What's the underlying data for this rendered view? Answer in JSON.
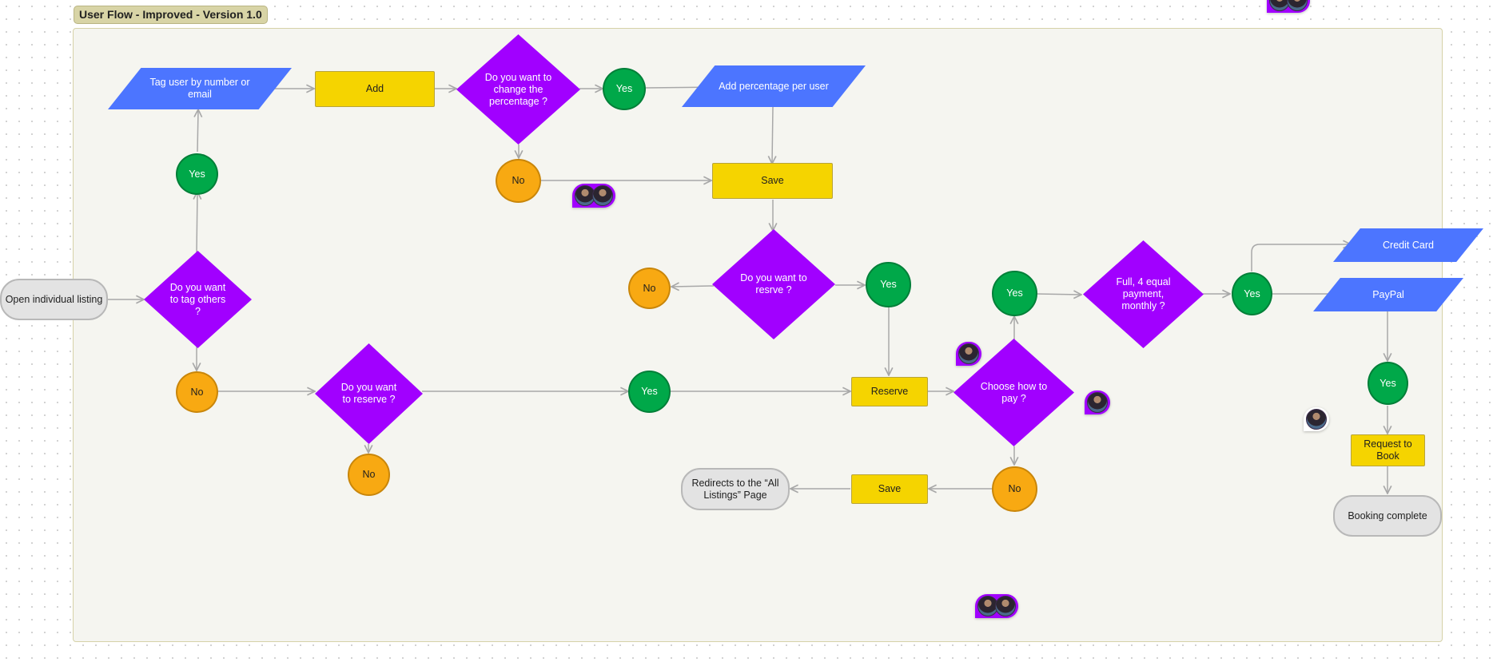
{
  "frame": {
    "title": "User Flow - Improved - Version 1.0"
  },
  "colors": {
    "decision": "#a100ff",
    "io": "#4c75ff",
    "process": "#f5d400",
    "yes": "#00a849",
    "no": "#f8a912",
    "terminal": "#e3e3e3",
    "connector": "#a8a8a8"
  },
  "nodes": {
    "open_listing": "Open individual listing",
    "q_tag_others": "Do you want to tag others ?",
    "yes_tag": "Yes",
    "no_tag": "No",
    "tag_user": "Tag user by number or email",
    "add": "Add",
    "q_change_pct": "Do you want to change the percentage ?",
    "yes_pct": "Yes",
    "no_pct": "No",
    "add_pct": "Add percentage per user",
    "save_top": "Save",
    "q_resrve": "Do you want to resrve ?",
    "no_resrve": "No",
    "yes_resrve": "Yes",
    "q_reserve": "Do you want to reserve ?",
    "no_reserve": "No",
    "yes_reserve": "Yes",
    "reserve": "Reserve",
    "q_pay": "Choose how to pay ?",
    "yes_pay": "Yes",
    "no_pay": "No",
    "save_bottom": "Save",
    "redirect": "Redirects to the “All Listings” Page",
    "q_full": "Full, 4 equal payment, monthly ?",
    "yes_full": "Yes",
    "credit_card": "Credit Card",
    "paypal": "PayPal",
    "yes_paypal": "Yes",
    "request_book": "Request to Book",
    "booking_complete": "Booking complete"
  },
  "collaborators": [
    {
      "id": "cursor-group-1",
      "count": 2
    },
    {
      "id": "cursor-group-2",
      "count": 1
    },
    {
      "id": "cursor-group-3",
      "count": 1
    },
    {
      "id": "cursor-group-4",
      "count": 1
    },
    {
      "id": "cursor-group-5",
      "count": 2
    },
    {
      "id": "cursor-group-6",
      "count": 2
    }
  ]
}
